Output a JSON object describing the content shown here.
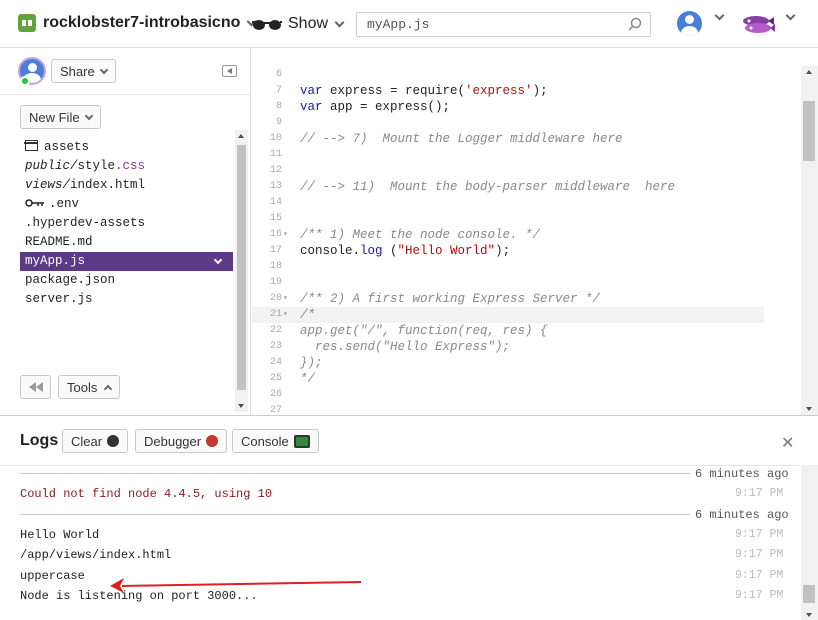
{
  "topbar": {
    "project_name": "rocklobster7-introbasicno",
    "show_label": "Show",
    "search_value": "myApp.js"
  },
  "sidebar": {
    "share_label": "Share",
    "new_file_label": "New File",
    "tools_label": "Tools",
    "files": [
      {
        "icon": "box-icon",
        "name": "assets",
        "parts": [
          {
            "t": "assets",
            "c": ""
          }
        ]
      },
      {
        "name": "public/style.css",
        "parts": [
          {
            "t": "public/",
            "c": "ital"
          },
          {
            "t": "style",
            "c": ""
          },
          {
            "t": ".css",
            "c": "ext"
          }
        ]
      },
      {
        "name": "views/index.html",
        "parts": [
          {
            "t": "views/",
            "c": "ital"
          },
          {
            "t": "index.html",
            "c": ""
          }
        ]
      },
      {
        "icon": "key-icon",
        "name": ".env",
        "parts": [
          {
            "t": ".env",
            "c": ""
          }
        ]
      },
      {
        "name": ".hyperdev-assets",
        "parts": [
          {
            "t": ".hyperdev-assets",
            "c": ""
          }
        ]
      },
      {
        "name": "README.md",
        "parts": [
          {
            "t": "README.md",
            "c": ""
          }
        ]
      },
      {
        "name": "myApp.js",
        "selected": true,
        "parts": [
          {
            "t": "myApp.js",
            "c": ""
          }
        ]
      },
      {
        "name": "package.json",
        "parts": [
          {
            "t": "package.json",
            "c": ""
          }
        ]
      },
      {
        "name": "server.js",
        "parts": [
          {
            "t": "server.js",
            "c": ""
          }
        ]
      }
    ]
  },
  "editor": {
    "lines": [
      {
        "n": "6",
        "code": []
      },
      {
        "n": "7",
        "code": [
          {
            "t": "var",
            "c": "kw"
          },
          {
            "t": " express = require(",
            "c": ""
          },
          {
            "t": "'express'",
            "c": "str"
          },
          {
            "t": ");",
            "c": ""
          }
        ]
      },
      {
        "n": "8",
        "code": [
          {
            "t": "var",
            "c": "kw"
          },
          {
            "t": " app = express();",
            "c": ""
          }
        ]
      },
      {
        "n": "9",
        "code": []
      },
      {
        "n": "10",
        "code": [
          {
            "t": "// --> 7)  Mount the Logger middleware here",
            "c": "cmt"
          }
        ]
      },
      {
        "n": "11",
        "code": []
      },
      {
        "n": "12",
        "code": []
      },
      {
        "n": "13",
        "code": [
          {
            "t": "// --> 11)  Mount the body-parser middleware  here",
            "c": "cmt"
          }
        ]
      },
      {
        "n": "14",
        "code": []
      },
      {
        "n": "15",
        "code": []
      },
      {
        "n": "16",
        "fold": true,
        "code": [
          {
            "t": "/** 1) Meet the node console. */",
            "c": "cmt"
          }
        ]
      },
      {
        "n": "17",
        "code": [
          {
            "t": "console.",
            "c": ""
          },
          {
            "t": "log",
            "c": "kw"
          },
          {
            "t": " (",
            "c": ""
          },
          {
            "t": "\"Hello World\"",
            "c": "str"
          },
          {
            "t": ");",
            "c": ""
          }
        ]
      },
      {
        "n": "18",
        "code": []
      },
      {
        "n": "19",
        "code": []
      },
      {
        "n": "20",
        "fold": true,
        "code": [
          {
            "t": "/** 2) A first working Express Server */",
            "c": "cmt"
          }
        ]
      },
      {
        "n": "21",
        "fold": true,
        "hl": true,
        "code": [
          {
            "t": "/*",
            "c": "cmt"
          }
        ]
      },
      {
        "n": "22",
        "code": [
          {
            "t": "app.get(\"/\", function(req, res) {",
            "c": "cmt"
          }
        ]
      },
      {
        "n": "23",
        "code": [
          {
            "t": "  res.send(\"Hello Express\");",
            "c": "cmt"
          }
        ]
      },
      {
        "n": "24",
        "code": [
          {
            "t": "});",
            "c": "cmt"
          }
        ]
      },
      {
        "n": "25",
        "code": [
          {
            "t": "*/",
            "c": "cmt"
          }
        ]
      },
      {
        "n": "26",
        "code": []
      },
      {
        "n": "27",
        "code": []
      }
    ]
  },
  "logs": {
    "title": "Logs",
    "clear_label": "Clear",
    "debugger_label": "Debugger",
    "console_label": "Console",
    "close_glyph": "✕",
    "entries": [
      {
        "kind": "sep",
        "label": "6 minutes ago"
      },
      {
        "kind": "err",
        "text": "Could not find node 4.4.5, using 10",
        "time": "9:17 PM"
      },
      {
        "kind": "sep",
        "label": "6 minutes ago"
      },
      {
        "kind": "line",
        "text": "Hello World",
        "time": "9:17 PM"
      },
      {
        "kind": "line",
        "text": "/app/views/index.html",
        "time": "9:17 PM"
      },
      {
        "kind": "line",
        "text": "uppercase",
        "time": "9:17 PM"
      },
      {
        "kind": "line",
        "text": "Node is listening on port 3000...",
        "time": "9:17 PM"
      }
    ]
  }
}
